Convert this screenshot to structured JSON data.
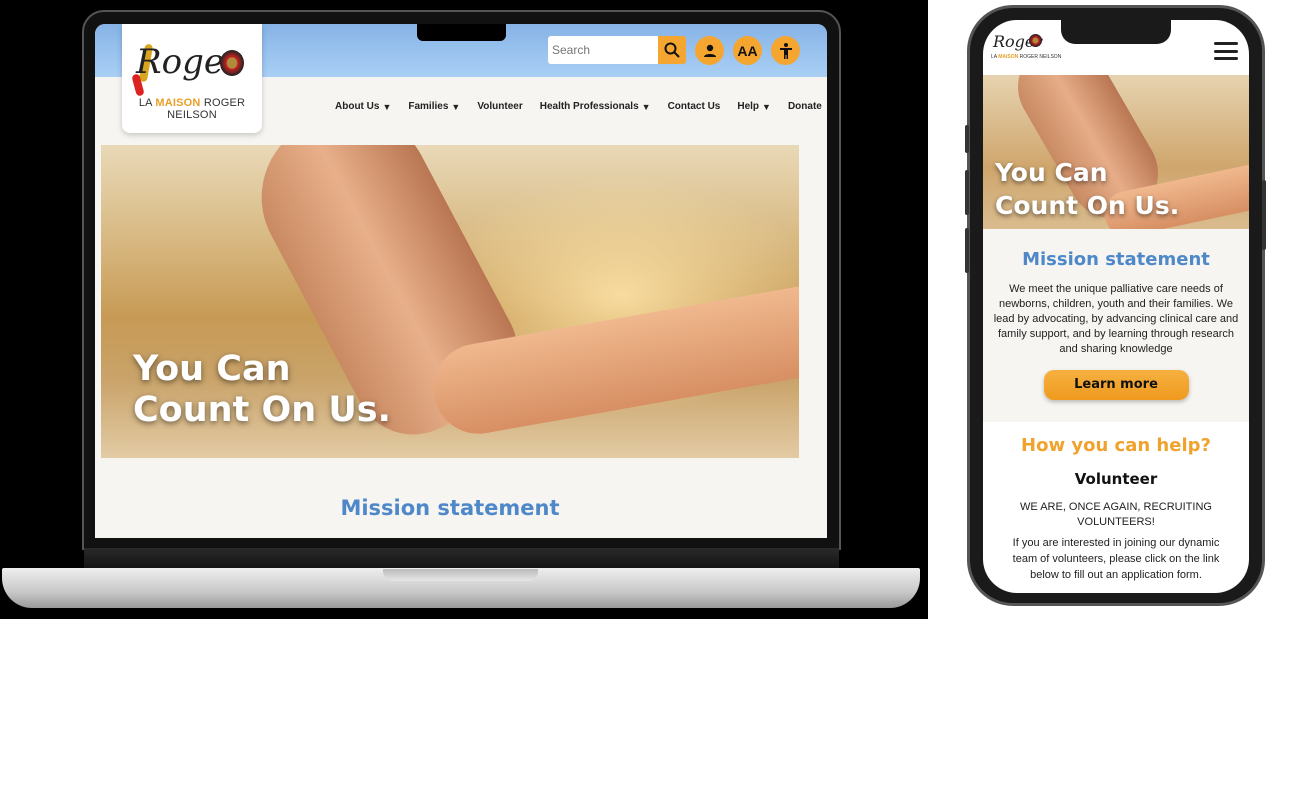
{
  "desktop": {
    "logo": {
      "wordmark": "Roger",
      "brand_prefix": "LA",
      "brand_highlight": "MAISON",
      "brand_suffix": "ROGER NEILSON"
    },
    "search": {
      "placeholder": "Search"
    },
    "nav": [
      {
        "label": "About Us",
        "dropdown": true
      },
      {
        "label": "Families",
        "dropdown": true
      },
      {
        "label": "Volunteer",
        "dropdown": false
      },
      {
        "label": "Health Professionals",
        "dropdown": true
      },
      {
        "label": "Contact Us",
        "dropdown": false
      },
      {
        "label": "Help",
        "dropdown": true
      },
      {
        "label": "Donate",
        "dropdown": false
      }
    ],
    "text_size_label": "AA",
    "hero_line1": "You Can",
    "hero_line2": "Count On Us.",
    "mission_title": "Mission statement"
  },
  "mobile": {
    "hero_line1": "You Can",
    "hero_line2": "Count On Us.",
    "mission_title": "Mission statement",
    "mission_text": "We meet the unique palliative care needs of newborns, children, youth and their families. We lead by advocating, by advancing clinical care and family support, and by learning through research and sharing knowledge",
    "learn_more": "Learn more",
    "help_title": "How you can help?",
    "volunteer_title": "Volunteer",
    "volunteer_caps": "WE ARE, ONCE AGAIN, RECRUITING VOLUNTEERS!",
    "volunteer_text": "If you are interested in joining our dynamic team of volunteers, please click on the link below to fill out an application form."
  },
  "colors": {
    "accent": "#f4a630",
    "blue": "#4e88c9",
    "header": "#86b3e6"
  }
}
